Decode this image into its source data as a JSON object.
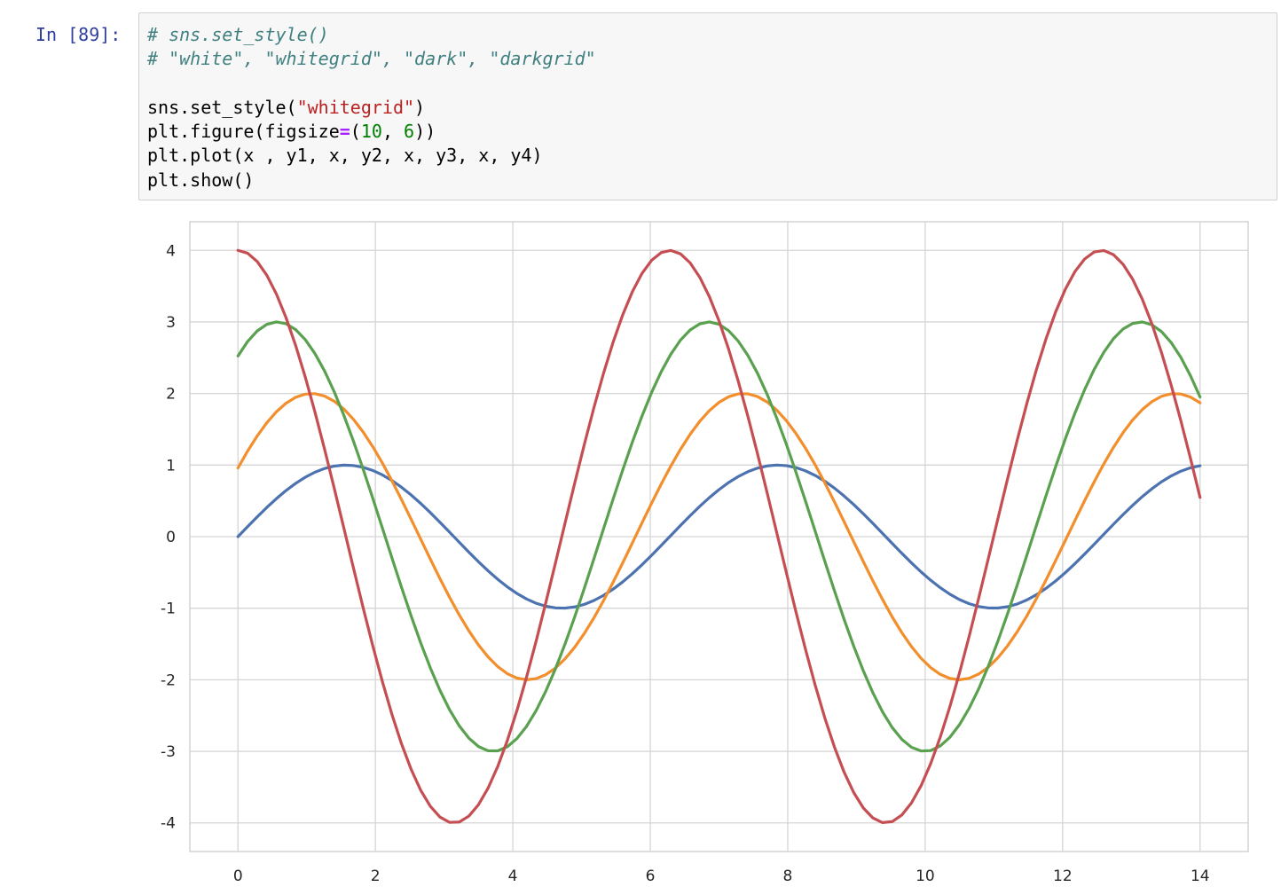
{
  "cell": {
    "prompt": "In [89]:",
    "lines": {
      "l1": "# sns.set_style()",
      "l2": "# \"white\", \"whitegrid\", \"dark\", \"darkgrid\"",
      "l4a": "sns.set_style(",
      "l4b": "\"whitegrid\"",
      "l4c": ")",
      "l5a": "plt.figure(figsize",
      "l5b": "=",
      "l5c": "(",
      "l5d": "10",
      "l5e": ", ",
      "l5f": "6",
      "l5g": "))",
      "l6": "plt.plot(x , y1, x, y2, x, y3, x, y4)",
      "l7": "plt.show()"
    }
  },
  "chart_data": {
    "type": "line",
    "title": "",
    "xlabel": "",
    "ylabel": "",
    "xlim": [
      -0.7,
      14.7
    ],
    "ylim": [
      -4.4,
      4.4
    ],
    "xticks": [
      0,
      2,
      4,
      6,
      8,
      10,
      12,
      14
    ],
    "yticks": [
      4,
      3,
      2,
      1,
      0,
      -1,
      -2,
      -3,
      -4
    ],
    "grid": true,
    "style": "whitegrid",
    "x": {
      "start": 0,
      "stop": 14,
      "num": 101
    },
    "series": [
      {
        "color": "#4c72b0",
        "amplitude": 1,
        "frequency": 1,
        "phase": 0
      },
      {
        "color": "#f28e2b",
        "amplitude": 2,
        "frequency": 1,
        "phase": 0.5
      },
      {
        "color": "#59a14f",
        "amplitude": 3,
        "frequency": 1,
        "phase": 1
      },
      {
        "color": "#c44e52",
        "amplitude": 4,
        "frequency": 1,
        "phase": 1.5708
      }
    ]
  }
}
